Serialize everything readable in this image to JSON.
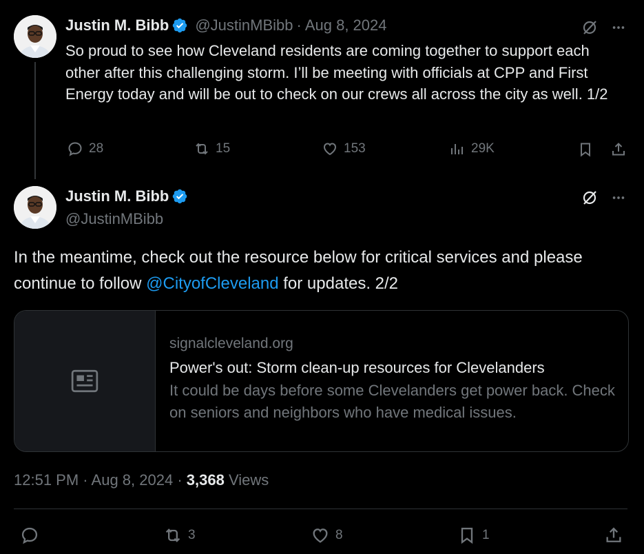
{
  "tweet1": {
    "name": "Justin M. Bibb",
    "handle": "@JustinMBibb",
    "dot": "·",
    "date": "Aug 8, 2024",
    "text": "So proud to see how Cleveland residents are coming together to support each other after this challenging storm. I’ll be meeting with officials at CPP and First Energy today and will be out to check on our crews all across the city as well. 1/2",
    "actions": {
      "replies": "28",
      "reposts": "15",
      "likes": "153",
      "views": "29K"
    }
  },
  "tweet2": {
    "name": "Justin M. Bibb",
    "handle": "@JustinMBibb",
    "text_before": "In the meantime, check out the resource below for critical services and please continue to follow ",
    "mention": "@CityofCleveland",
    "text_after": " for updates.   2/2",
    "card": {
      "domain": "signalcleveland.org",
      "title": "Power's out: Storm clean-up resources for Clevelanders",
      "description": "It could be days before some Clevelanders get power back. Check on seniors and neighbors who have medical issues.",
      "icon": "article-icon"
    },
    "meta": {
      "time": "12:51 PM",
      "dot": "·",
      "date": "Aug 8, 2024",
      "views_count": "3,368",
      "views_label": "Views"
    },
    "actions": {
      "reposts": "3",
      "likes": "8",
      "bookmarks": "1"
    }
  },
  "colors": {
    "background": "#000000",
    "text": "#e7e9ea",
    "muted": "#71767b",
    "link": "#1d9bf0",
    "verified": "#1d9bf0",
    "border": "#2f3336"
  }
}
